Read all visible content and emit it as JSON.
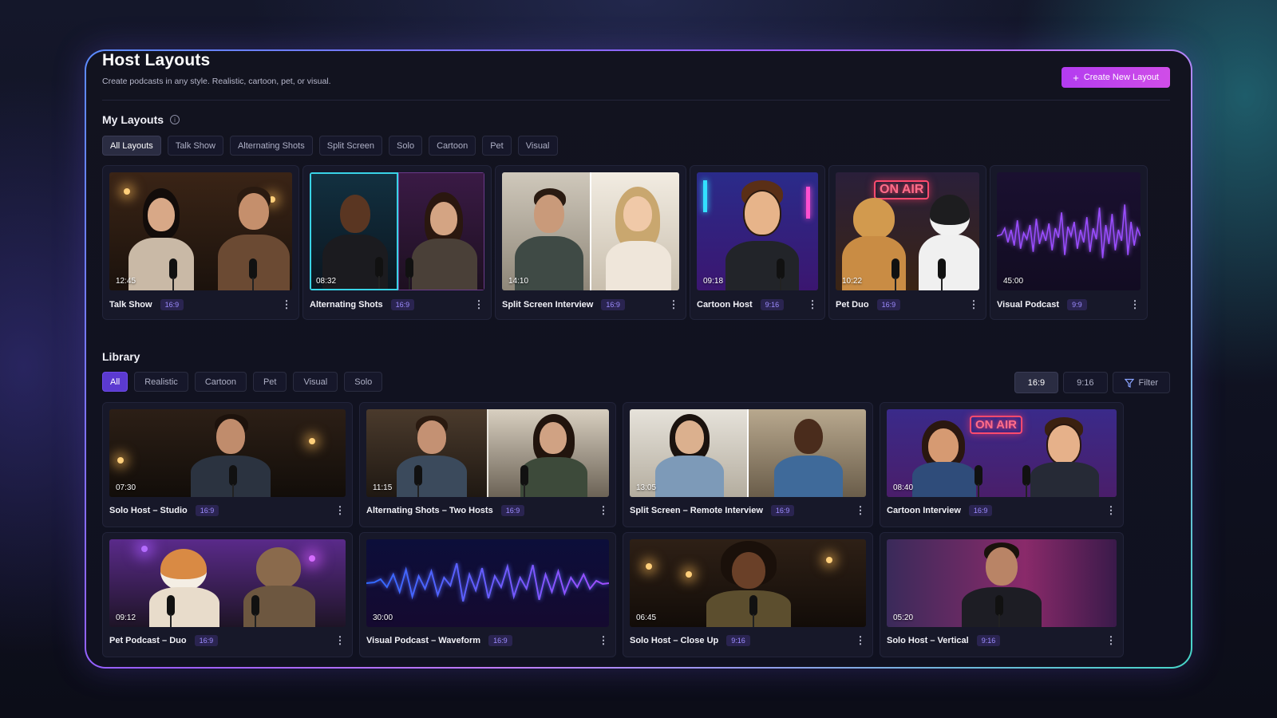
{
  "header": {
    "title": "Host Layouts",
    "subtitle": "Create podcasts in any style. Realistic, cartoon, pet, or visual.",
    "create_label": "Create New Layout",
    "create_icon": "plus-icon"
  },
  "my_layouts": {
    "title": "My Layouts",
    "filters": [
      "All Layouts",
      "Talk Show",
      "Alternating Shots",
      "Split Screen",
      "Solo",
      "Cartoon",
      "Pet",
      "Visual"
    ],
    "active_filter": "All Layouts",
    "cards": [
      {
        "name": "Talk Show",
        "ratio": "16:9",
        "duration": "12:45"
      },
      {
        "name": "Alternating Shots",
        "ratio": "16:9",
        "duration": "08:32"
      },
      {
        "name": "Split Screen Interview",
        "ratio": "16:9",
        "duration": "14:10"
      },
      {
        "name": "Cartoon Host",
        "ratio": "9:16",
        "duration": "09:18"
      },
      {
        "name": "Pet Duo",
        "ratio": "16:9",
        "duration": "10:22"
      },
      {
        "name": "Visual Podcast",
        "ratio": "9:9",
        "duration": "45:00"
      }
    ]
  },
  "library": {
    "title": "Library",
    "filters": [
      "All",
      "Realistic",
      "Cartoon",
      "Pet",
      "Visual",
      "Solo"
    ],
    "active_filter": "All",
    "aspect_options": [
      "16:9",
      "9:16"
    ],
    "active_aspect": "16:9",
    "filter_label": "Filter",
    "cards": [
      {
        "name": "Solo Host – Studio",
        "ratio": "16:9",
        "duration": "07:30"
      },
      {
        "name": "Alternating Shots – Two Hosts",
        "ratio": "16:9",
        "duration": "11:15"
      },
      {
        "name": "Split Screen – Remote Interview",
        "ratio": "16:9",
        "duration": "13:05"
      },
      {
        "name": "Cartoon Interview",
        "ratio": "16:9",
        "duration": "08:40"
      },
      {
        "name": "Pet Podcast – Duo",
        "ratio": "16:9",
        "duration": "09:12"
      },
      {
        "name": "Visual Podcast – Waveform",
        "ratio": "16:9",
        "duration": "30:00"
      },
      {
        "name": "Solo Host – Close Up",
        "ratio": "9:16",
        "duration": "06:45"
      },
      {
        "name": "Solo Host – Vertical",
        "ratio": "9:16",
        "duration": "05:20"
      }
    ]
  },
  "neon_sign": "ON AIR",
  "colors": {
    "accent": "#c044ec",
    "active_chip": "#5b3ad0",
    "ratio_badge": "#9d8cff",
    "panel_bg": "#12131f"
  }
}
